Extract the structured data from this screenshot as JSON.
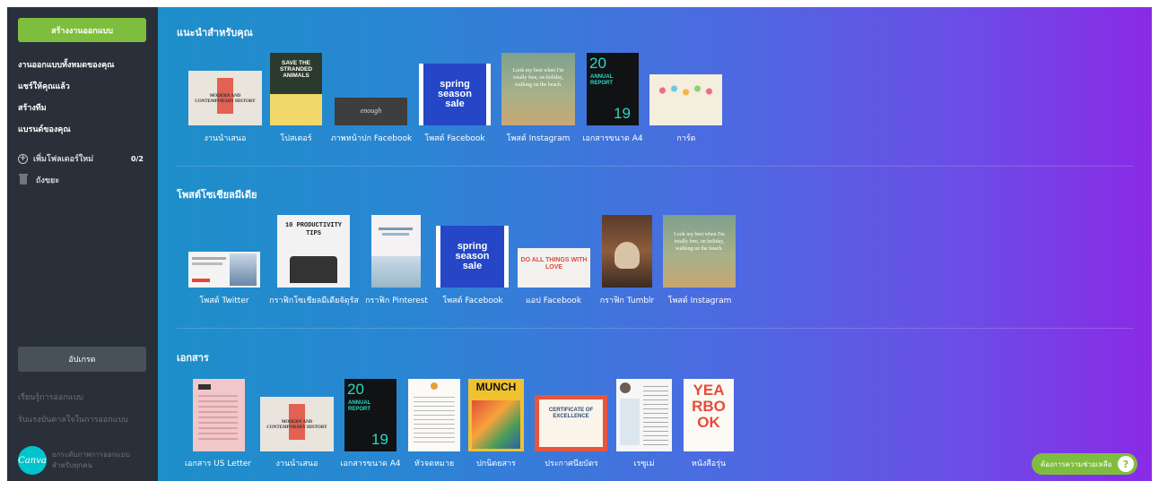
{
  "sidebar": {
    "create_label": "สร้างงานออกแบบ",
    "nav": [
      "งานออกแบบทั้งหมดของคุณ",
      "แชร์ให้คุณแล้ว",
      "สร้างทีม",
      "แบรนด์ของคุณ"
    ],
    "new_folder_label": "เพิ่มโฟลเดอร์ใหม่",
    "folder_count": "0/2",
    "trash_label": "ถังขยะ",
    "upgrade_label": "อัปเกรด",
    "learn_link": "เรียนรู้การออกแบบ",
    "inspire_link": "รับแรงบันดาลใจในการออกแบบ",
    "logo_text": "Canva",
    "tagline_1": "ยกระดับภาพการออกแบบ",
    "tagline_2": "สำหรับทุกคน"
  },
  "sections": {
    "recommended": {
      "title": "แนะนำสำหรับคุณ",
      "items": [
        "งานนำเสนอ",
        "โปสเตอร์",
        "ภาพหน้าปก Facebook",
        "โพสต์ Facebook",
        "โพสต์ Instagram",
        "เอกสารขนาด A4",
        "การ์ด"
      ]
    },
    "social": {
      "title": "โพสต์โซเชียลมีเดีย",
      "items": [
        "โพสต์ Twitter",
        "กราฟิกโซเชียลมีเดียจัตุรัส",
        "กราฟิก Pinterest",
        "โพสต์ Facebook",
        "แอป Facebook",
        "กราฟิก Tumblr",
        "โพสต์ Instagram"
      ]
    },
    "documents": {
      "title": "เอกสาร",
      "items": [
        "เอกสาร US Letter",
        "งานนำเสนอ",
        "เอกสารขนาด A4",
        "หัวจดหมาย",
        "ปกนิตยสาร",
        "ประกาศนียบัตร",
        "เรซูเม่",
        "หนังสือรุ่น"
      ]
    }
  },
  "thumb_text": {
    "modern": "MODERN AND CONTEMPORARY HISTORY",
    "save": "SAVE THE STRANDED ANIMALS",
    "enough": "enough",
    "spring": "spring season sale",
    "beach": "Look my best when I'm totally free, on holiday, walking on the beach.",
    "year": "20",
    "year2": "19",
    "annual": "ANNUAL REPORT",
    "productivity": "10 PRODUCTIVITY TIPS",
    "dealt": "DO ALL THINGS WITH LOVE",
    "munch": "MUNCH",
    "cert": "CERTIFICATE OF EXCELLENCE",
    "yearbook": "YEARBOOK"
  },
  "help_label": "ต้องการความช่วยเหลือ",
  "colors": {
    "accent": "#7fbd3f",
    "sidebar": "#293039"
  }
}
